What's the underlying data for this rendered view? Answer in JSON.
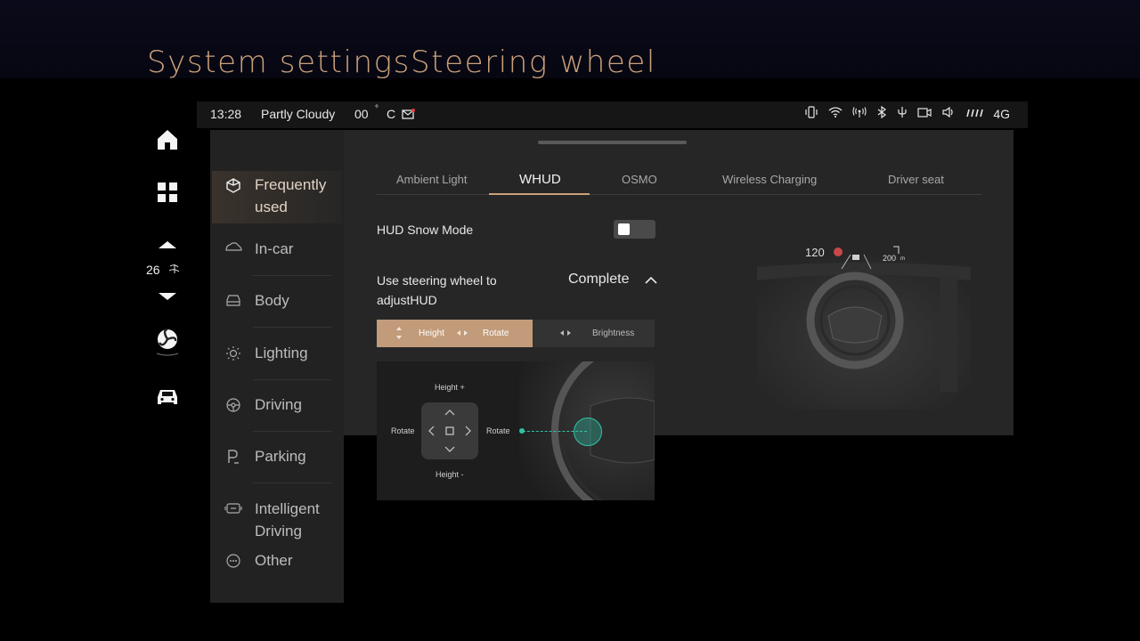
{
  "titles": {
    "left": "System settings",
    "right": "Steering wheel"
  },
  "status": {
    "time": "13:28",
    "weather": "Partly Cloudy",
    "temp_value": "00",
    "temp_unit": "C",
    "network": "4G"
  },
  "rail": {
    "temperature": "26"
  },
  "sidebar": {
    "items": [
      {
        "label_line1": "Frequently",
        "label_line2": "used",
        "icon": "cube-icon"
      },
      {
        "label": "In-car",
        "icon": "car-outline-icon"
      },
      {
        "label": "Body",
        "icon": "car-body-icon"
      },
      {
        "label": "Lighting",
        "icon": "sun-icon"
      },
      {
        "label": "Driving",
        "icon": "steering-wheel-icon"
      },
      {
        "label": "Parking",
        "icon": "parking-icon"
      },
      {
        "label_line1": "Intelligent",
        "label_line2": "Driving",
        "icon": "assist-icon"
      },
      {
        "label": "Other",
        "icon": "more-icon"
      }
    ]
  },
  "tabs": [
    "Ambient Light",
    "WHUD",
    "OSMO",
    "Wireless Charging",
    "Driver seat"
  ],
  "settings": {
    "hud_snow_mode": "HUD Snow Mode",
    "hud_snow_mode_on": false,
    "steering_line1": "Use steering wheel to",
    "steering_line2": "adjustHUD",
    "complete": "Complete"
  },
  "segment": {
    "height": "Height",
    "rotate": "Rotate",
    "brightness": "Brightness"
  },
  "illustration": {
    "height_plus": "Height +",
    "height_minus": "Height -",
    "rotate_left": "Rotate",
    "rotate_right": "Rotate"
  },
  "hud_preview": {
    "speed": "120",
    "distance": "200",
    "distance_unit": "m"
  },
  "colors": {
    "accent": "#c9a07a",
    "segment_active": "#c29b7a",
    "teal": "#2ec4a6"
  }
}
